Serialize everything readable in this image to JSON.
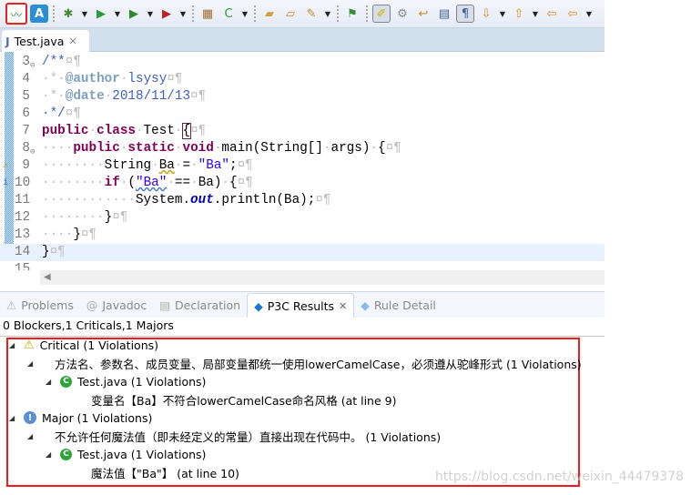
{
  "toolbar": {
    "icons": [
      "activity-monitor-icon",
      "text-icon",
      "debug-icon",
      "run-icon",
      "coverage-icon",
      "run-external-icon",
      "new-package-icon",
      "new-class-icon",
      "open-folder-icon",
      "open-task-icon",
      "pen-icon",
      "link-icon",
      "highlight-icon",
      "share-icon",
      "word-wrap-icon",
      "block-select-icon",
      "show-whitespace-icon",
      "next-annotation-icon",
      "prev-annotation-icon",
      "last-edit-icon",
      "back-icon"
    ]
  },
  "editor": {
    "tab_label": "Test.java",
    "lines": [
      {
        "n": "3",
        "fold": "⊖",
        "t": [
          [
            "/**",
            "cm"
          ],
          [
            "¤¶",
            "ws"
          ]
        ]
      },
      {
        "n": "4",
        "t": [
          [
            "·*·",
            "ws"
          ],
          [
            "@author",
            "tag"
          ],
          [
            "·",
            "ws"
          ],
          [
            "lsysy",
            "cm"
          ],
          [
            "¤¶",
            "ws"
          ]
        ]
      },
      {
        "n": "5",
        "t": [
          [
            "·*·",
            "ws"
          ],
          [
            "@date",
            "tag"
          ],
          [
            "·",
            "ws"
          ],
          [
            "2018/11/13",
            "cm"
          ],
          [
            "¤¶",
            "ws"
          ]
        ]
      },
      {
        "n": "6",
        "t": [
          [
            "·*/",
            "cm"
          ],
          [
            "¤¶",
            "ws"
          ]
        ]
      },
      {
        "n": "7",
        "t": [
          [
            "public",
            "kw"
          ],
          [
            "·",
            "ws"
          ],
          [
            "class",
            "kw"
          ],
          [
            "·",
            "ws"
          ],
          [
            "Test",
            ""
          ],
          [
            "·",
            "ws"
          ],
          [
            "{",
            "brk"
          ],
          [
            "¤¶",
            "ws"
          ]
        ]
      },
      {
        "n": "8",
        "fold": "⊖",
        "t": [
          [
            "····",
            "ws"
          ],
          [
            "public",
            "kw"
          ],
          [
            "·",
            "ws"
          ],
          [
            "static",
            "kw"
          ],
          [
            "·",
            "ws"
          ],
          [
            "void",
            "kw"
          ],
          [
            "·",
            "ws"
          ],
          [
            "main(String[]",
            ""
          ],
          [
            "·",
            "ws"
          ],
          [
            "args)",
            ""
          ],
          [
            "·",
            "ws"
          ],
          [
            "{",
            ""
          ],
          [
            "¤¶",
            "ws"
          ]
        ]
      },
      {
        "n": "9",
        "marker": "⚠",
        "t": [
          [
            "········",
            "ws"
          ],
          [
            "String",
            ""
          ],
          [
            "·",
            "ws"
          ],
          [
            "Ba",
            "warnu"
          ],
          [
            "·",
            "ws"
          ],
          [
            "=",
            ""
          ],
          [
            "·",
            "ws"
          ],
          [
            "\"Ba\"",
            "str"
          ],
          [
            ";",
            ""
          ],
          [
            "¤¶",
            "ws"
          ]
        ]
      },
      {
        "n": "10",
        "marker": "i",
        "t": [
          [
            "········",
            "ws"
          ],
          [
            "if",
            "kw"
          ],
          [
            "·",
            "ws"
          ],
          [
            "(",
            ""
          ],
          [
            "\"Ba\"",
            "str infou"
          ],
          [
            "·",
            "ws"
          ],
          [
            "==",
            ""
          ],
          [
            "·",
            "ws"
          ],
          [
            "Ba)",
            ""
          ],
          [
            "·",
            "ws"
          ],
          [
            "{",
            ""
          ],
          [
            "¤¶",
            "ws"
          ]
        ]
      },
      {
        "n": "11",
        "t": [
          [
            "············",
            "ws"
          ],
          [
            "System.",
            ""
          ],
          [
            "out",
            "fld"
          ],
          [
            ".println(Ba);",
            ""
          ],
          [
            "¤¶",
            "ws"
          ]
        ]
      },
      {
        "n": "12",
        "t": [
          [
            "········",
            "ws"
          ],
          [
            "}",
            ""
          ],
          [
            "¤¶",
            "ws"
          ]
        ]
      },
      {
        "n": "13",
        "t": [
          [
            "····",
            "ws"
          ],
          [
            "}",
            ""
          ],
          [
            "¤¶",
            "ws"
          ]
        ]
      },
      {
        "n": "14",
        "cur": true,
        "t": [
          [
            "}",
            ""
          ],
          [
            "¤¶",
            "ws"
          ]
        ]
      },
      {
        "n": "15",
        "t": []
      }
    ]
  },
  "panel": {
    "tabs": [
      {
        "label": "Problems",
        "icon": "problems-icon",
        "glyph": "⚠"
      },
      {
        "label": "Javadoc",
        "icon": "at-icon",
        "glyph": "@"
      },
      {
        "label": "Declaration",
        "icon": "declaration-icon",
        "glyph": "▤"
      },
      {
        "label": "P3C Results",
        "icon": "p3c-icon",
        "glyph": "◆",
        "active": true
      },
      {
        "label": "Rule Detail",
        "icon": "p3c-icon",
        "glyph": "◆"
      }
    ],
    "summary": "0 Blockers,1 Criticals,1 Majors",
    "tree": [
      {
        "level": 0,
        "icon": "warning-icon",
        "label": "Critical (1 Violations)"
      },
      {
        "level": 1,
        "label": "方法名、参数名、成员变量、局部变量都统一使用lowerCamelCase，必须遵从驼峰形式 (1 Violations)"
      },
      {
        "level": 2,
        "icon": "class-icon",
        "label": "Test.java (1 Violations)"
      },
      {
        "level": 3,
        "label": "变量名【Ba】不符合lowerCamelCase命名风格 (at line 9)"
      },
      {
        "level": 0,
        "icon": "info-icon",
        "label": "Major (1 Violations)"
      },
      {
        "level": 1,
        "label": "不允许任何魔法值（即未经定义的常量）直接出现在代码中。 (1 Violations)"
      },
      {
        "level": 2,
        "icon": "class-icon",
        "label": "Test.java (1 Violations)"
      },
      {
        "level": 3,
        "label": "魔法值【\"Ba\"】 (at line 10)"
      }
    ]
  },
  "watermark": "https://blog.csdn.net/weixin_44479378",
  "colors": {
    "highlight_box": "#f21a1a",
    "keyword": "#7f0055",
    "string": "#2a00ff"
  }
}
